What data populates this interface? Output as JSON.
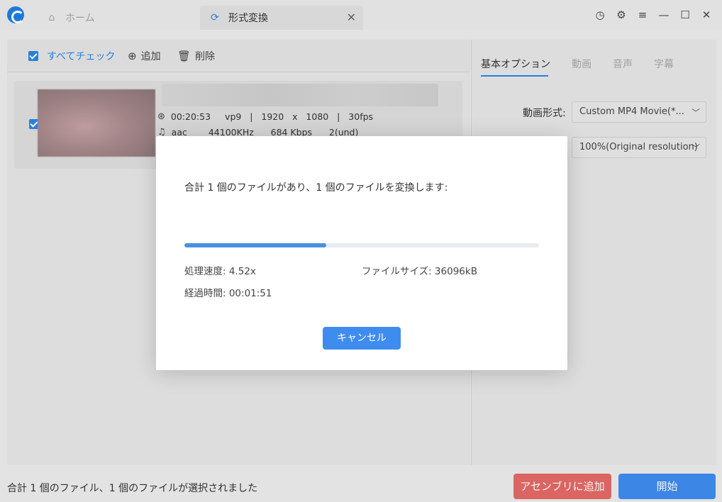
{
  "titlebar": {
    "home_tab": "ホーム",
    "convert_tab": "形式変換",
    "close_glyph": "✕",
    "controls": {
      "history": "◷",
      "settings": "⚙",
      "menu": "≡",
      "minimize": "—",
      "maximize": "☐",
      "close": "✕"
    }
  },
  "toolbar": {
    "check_all": "すべてチェック",
    "add": "追加",
    "delete": "削除"
  },
  "file": {
    "duration": "00:20:53",
    "video_meta": "vp9   |   1920   x   1080   |   30fps",
    "audio_codec": "aac",
    "audio_meta": "44100KHz      684 Kbps      2(und)"
  },
  "right_panel": {
    "tabs": [
      "基本オプション",
      "動画",
      "音声",
      "字幕"
    ],
    "format_label": "動画形式:",
    "format_value": "Custom MP4 Movie(*...",
    "resolution_value": "100%(Original resolution)"
  },
  "modal": {
    "message": "合計 1 個のファイルがあり、1 個のファイルを変換します:",
    "progress": 0.4,
    "speed": "処理速度: 4.52x",
    "filesize": "ファイルサイズ: 36096kB",
    "elapsed": "経過時間: 00:01:51",
    "cancel": "キャンセル"
  },
  "bottombar": {
    "status": "合計 1 個のファイル、1 個のファイルが選択されました",
    "assembly_button": "アセンブリに追加",
    "start_button": "開始"
  },
  "colors": {
    "accent": "#3f8cef",
    "danger": "#e36a66"
  }
}
